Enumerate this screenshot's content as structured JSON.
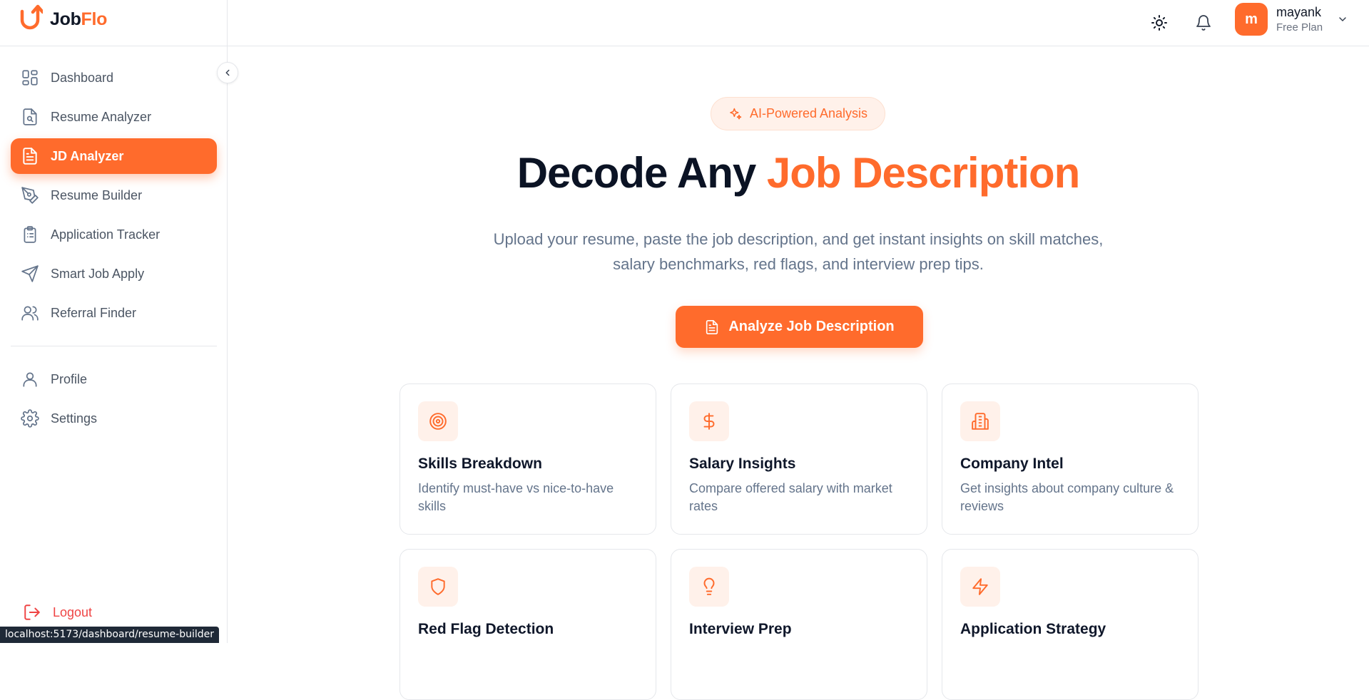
{
  "brand": {
    "name_part1": "Job",
    "name_part2": "Flo",
    "accent": "#ff6b2c"
  },
  "sidebar": {
    "items": [
      {
        "label": "Dashboard",
        "icon": "layout-grid-icon",
        "active": false
      },
      {
        "label": "Resume Analyzer",
        "icon": "file-search-icon",
        "active": false
      },
      {
        "label": "JD Analyzer",
        "icon": "file-text-icon",
        "active": true
      },
      {
        "label": "Resume Builder",
        "icon": "pen-tool-icon",
        "active": false
      },
      {
        "label": "Application Tracker",
        "icon": "clipboard-list-icon",
        "active": false
      },
      {
        "label": "Smart Job Apply",
        "icon": "send-icon",
        "active": false
      },
      {
        "label": "Referral Finder",
        "icon": "users-icon",
        "active": false
      }
    ],
    "secondary": [
      {
        "label": "Profile",
        "icon": "user-icon"
      },
      {
        "label": "Settings",
        "icon": "gear-icon"
      }
    ],
    "logout_label": "Logout"
  },
  "topbar": {
    "user": {
      "initial": "m",
      "name": "mayank",
      "plan": "Free Plan"
    }
  },
  "hero": {
    "badge": "AI-Powered Analysis",
    "title_dark": "Decode Any ",
    "title_accent": "Job Description",
    "subtitle": "Upload your resume, paste the job description, and get instant insights on skill matches, salary benchmarks, red flags, and interview prep tips.",
    "cta_label": "Analyze Job Description"
  },
  "features": [
    {
      "title": "Skills Breakdown",
      "desc": "Identify must-have vs nice-to-have skills",
      "icon": "target-icon"
    },
    {
      "title": "Salary Insights",
      "desc": "Compare offered salary with market rates",
      "icon": "dollar-icon"
    },
    {
      "title": "Company Intel",
      "desc": "Get insights about company culture & reviews",
      "icon": "building-icon"
    },
    {
      "title": "Red Flag Detection",
      "desc": "",
      "icon": "shield-icon"
    },
    {
      "title": "Interview Prep",
      "desc": "",
      "icon": "lightbulb-icon"
    },
    {
      "title": "Application Strategy",
      "desc": "",
      "icon": "zap-icon"
    }
  ],
  "status_bar": {
    "url": "localhost:5173/dashboard/resume-builder"
  }
}
